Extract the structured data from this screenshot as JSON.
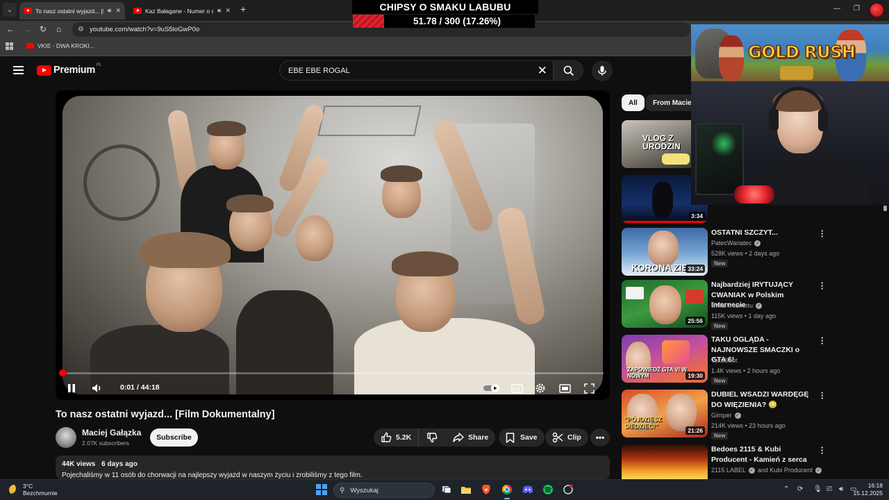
{
  "browser": {
    "tabs": [
      {
        "label": "To nasz ostatni wyjazd... [Fi",
        "active": true
      },
      {
        "label": "Kaz Bałagane - Numer o sp",
        "active": false
      }
    ],
    "url": "youtube.com/watch?v=9uS5loGwP0o",
    "bookmark": "VKIE - DWA KROKI..."
  },
  "stream_overlay": {
    "title": "CHIPSY O SMAKU LABUBU",
    "progress_text": "51.78 / 300 (17.26%)",
    "progress_fraction": 0.1726,
    "bar_color": "#e0242d"
  },
  "header": {
    "logo_text": "Premium",
    "logo_country": "PL",
    "search_value": "EBE EBE ROGAL"
  },
  "player": {
    "time_current": "0:01",
    "time_separator": "/",
    "time_total": "44:18",
    "progress_fraction": 0.001,
    "accent": "#ff0000"
  },
  "video": {
    "title": "To nasz ostatni wyjazd... [Film Dokumentalny]",
    "channel_name": "Maciej Gałązka",
    "channel_subs": "2.07K subscribers",
    "subscribe_label": "Subscribe",
    "likes": "5.2K",
    "share_label": "Share",
    "save_label": "Save",
    "clip_label": "Clip",
    "views": "44K views",
    "age": "6 days ago",
    "description": "Pojechaliśmy w 11 osób do chorwacji na najlepszy wyjazd w naszym życiu i zrobiliśmy z tego film."
  },
  "sidebar": {
    "chips": [
      "All",
      "From Maciej"
    ],
    "thumb_top_text": "VLOG Z URODZIN",
    "thumb_2_duration": "3:34",
    "recommendations": [
      {
        "title": "OSTATNI SZCZYT...",
        "channel": "PatecWariatec",
        "verified": true,
        "meta": "528K views • 2 days ago",
        "badge": "New",
        "duration": "33:24",
        "thumb_text": "KORONA ZIE"
      },
      {
        "title": "Najbardziej IRYTUJĄCY CWANIAK w Polskim Internecie",
        "channel": "Świat Internetu",
        "verified": true,
        "meta": "115K views • 1 day ago",
        "badge": "New",
        "duration": "25:56"
      },
      {
        "title": "TAKU OGLĄDA - NAJNOWSZE SMACZKI o GTA 6!",
        "channel": "TakuShot",
        "verified": false,
        "meta": "1.4K views • 2 hours ago",
        "badge": "New",
        "duration": "19:30",
        "thumb_text": "ZAPOWIEDŹ GTA VI W NOWYM"
      },
      {
        "title": "DUBIEL WSADZI WARDĘGĘ DO WIĘZIENIA? 😳",
        "channel": "Gimper",
        "verified": true,
        "meta": "214K views • 23 hours ago",
        "badge": "New",
        "duration": "21:26",
        "thumb_text": "\"PÓJDZIESZ SIEDZIEĆ!\""
      },
      {
        "title": "Bedoes 2115 & Kubi Producent - Kamień z serca",
        "channel": "2115 LABEL",
        "verified": true,
        "channel_extra": "and Kubi Producent",
        "meta": "",
        "badge": "",
        "duration": ""
      }
    ]
  },
  "game_banner": {
    "title": "GOLD RUSH"
  },
  "taskbar": {
    "temperature": "3°C",
    "condition": "Bezchmurnie",
    "search_placeholder": "Wyszukaj",
    "time": "16:18",
    "date": "15.12.2025"
  }
}
